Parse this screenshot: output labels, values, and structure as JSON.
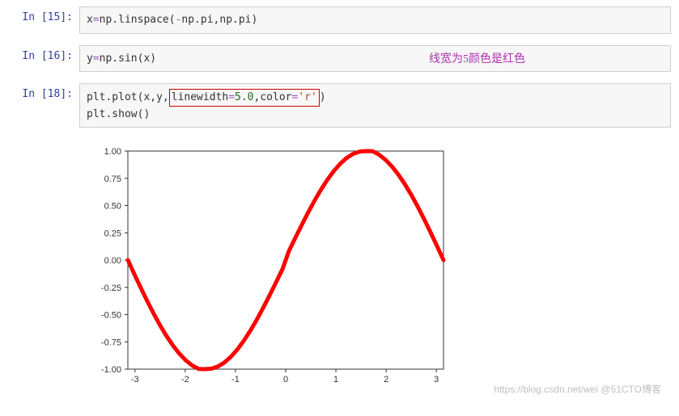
{
  "cells": [
    {
      "prompt_label": "In",
      "prompt_num": "[15]:",
      "code_html": "x<span class='tok-op'>=</span>np.linspace(<span class='tok-op'>-</span>np.pi,np.pi)"
    },
    {
      "prompt_label": "In",
      "prompt_num": "[16]:",
      "code_html": "y<span class='tok-op'>=</span>np.sin(x)"
    },
    {
      "prompt_label": "In",
      "prompt_num": "[18]:",
      "code_html": "plt.plot(x,y,<span class='hlbox'>linewidth<span class='tok-op'>=</span><span class='tok-num'>5.0</span>,color<span class='tok-op'>=</span><span class='tok-str'>'r'</span></span>)\nplt.show()"
    }
  ],
  "annotation_text": "线宽为5颜色是红色",
  "watermark": "https://blog.csdn.net/wei  @51CTO博客",
  "chart_data": {
    "type": "line",
    "title": "",
    "xlabel": "",
    "ylabel": "",
    "xlim": [
      -3.14159,
      3.14159
    ],
    "ylim": [
      -1.0,
      1.0
    ],
    "x_ticks": [
      -3,
      -2,
      -1,
      0,
      1,
      2,
      3
    ],
    "y_ticks": [
      -1.0,
      -0.75,
      -0.5,
      -0.25,
      0.0,
      0.25,
      0.5,
      0.75,
      1.0
    ],
    "series": [
      {
        "name": "sin(x)",
        "color": "#ff0000",
        "linewidth": 5,
        "x": [
          -3.1416,
          -3.0133,
          -2.885,
          -2.7567,
          -2.6284,
          -2.5001,
          -2.3718,
          -2.2435,
          -2.1152,
          -1.9869,
          -1.8586,
          -1.7303,
          -1.602,
          -1.4737,
          -1.3454,
          -1.2171,
          -1.0888,
          -0.9605,
          -0.8322,
          -0.7039,
          -0.5756,
          -0.4473,
          -0.319,
          -0.1907,
          -0.0624,
          0.0624,
          0.1907,
          0.319,
          0.4473,
          0.5756,
          0.7039,
          0.8322,
          0.9605,
          1.0888,
          1.2171,
          1.3454,
          1.4737,
          1.602,
          1.7303,
          1.8586,
          1.9869,
          2.1152,
          2.2435,
          2.3718,
          2.5001,
          2.6284,
          2.7567,
          2.885,
          3.0133,
          3.1416
        ],
        "y": [
          0.0,
          -0.1279,
          -0.2537,
          -0.3753,
          -0.4907,
          -0.5985,
          -0.6967,
          -0.7839,
          -0.8587,
          -0.9199,
          -0.9668,
          -0.9985,
          -0.9996,
          -0.9954,
          -0.9746,
          -0.9376,
          -0.8851,
          -0.8183,
          -0.7385,
          -0.6472,
          -0.5461,
          -0.4369,
          -0.3217,
          -0.2025,
          -0.0815,
          0.0815,
          0.2025,
          0.3217,
          0.4369,
          0.5461,
          0.6472,
          0.7385,
          0.8183,
          0.8851,
          0.9376,
          0.9746,
          0.9954,
          0.9996,
          0.9985,
          0.9668,
          0.9199,
          0.8587,
          0.7839,
          0.6967,
          0.5985,
          0.4907,
          0.3753,
          0.2537,
          0.1279,
          0.0
        ]
      }
    ]
  }
}
